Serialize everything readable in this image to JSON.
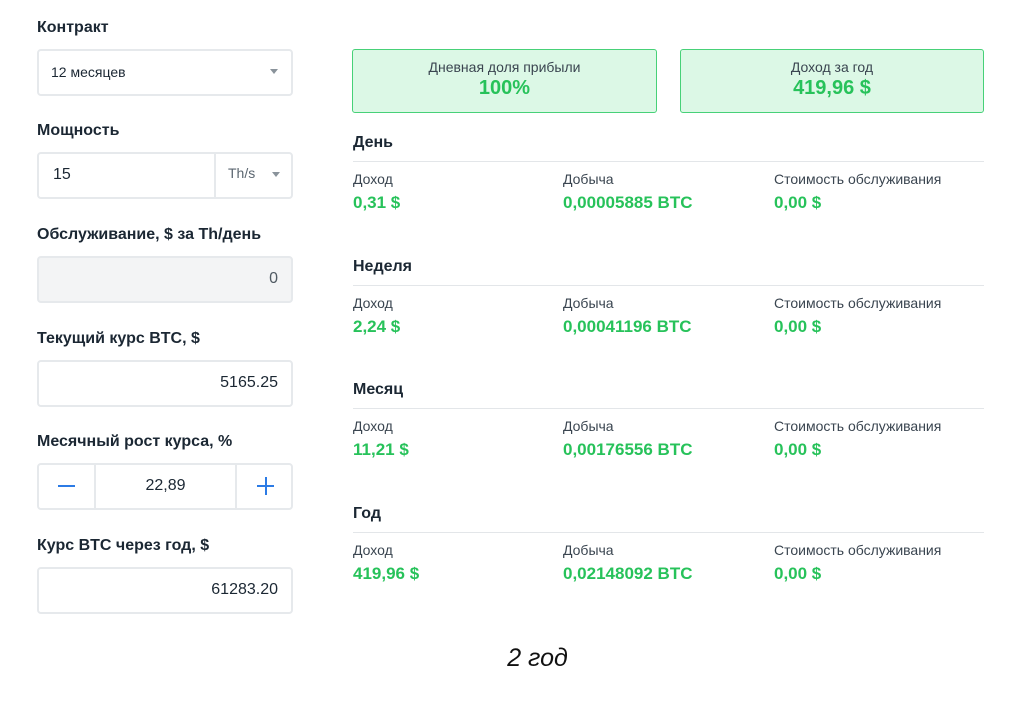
{
  "form": {
    "contract": {
      "label": "Контракт",
      "value": "12 месяцев"
    },
    "power": {
      "label": "Мощность",
      "value": "15",
      "unit": "Th/s"
    },
    "maintenance": {
      "label": "Обслуживание, $ за Th/день",
      "value": "0"
    },
    "btc_rate": {
      "label": "Текущий курс BTC, $",
      "value": "5165.25"
    },
    "monthly_growth": {
      "label": "Месячный рост курса, %",
      "value": "22,89"
    },
    "btc_rate_year": {
      "label": "Курс BTC через год, $",
      "value": "61283.20"
    }
  },
  "summary": {
    "daily_share": {
      "title": "Дневная доля прибыли",
      "value": "100%"
    },
    "year_income": {
      "title": "Доход за год",
      "value": "419,96 $"
    }
  },
  "sections": [
    {
      "title": "День",
      "income_label": "Доход",
      "income": "0,31 $",
      "mining_label": "Добыча",
      "mining": "0,00005885 BTC",
      "cost_label": "Стоимость обслуживания",
      "cost": "0,00 $"
    },
    {
      "title": "Неделя",
      "income_label": "Доход",
      "income": "2,24 $",
      "mining_label": "Добыча",
      "mining": "0,00041196 BTC",
      "cost_label": "Стоимость обслуживания",
      "cost": "0,00 $"
    },
    {
      "title": "Месяц",
      "income_label": "Доход",
      "income": "11,21 $",
      "mining_label": "Добыча",
      "mining": "0,00176556 BTC",
      "cost_label": "Стоимость обслуживания",
      "cost": "0,00 $"
    },
    {
      "title": "Год",
      "income_label": "Доход",
      "income": "419,96 $",
      "mining_label": "Добыча",
      "mining": "0,02148092 BTC",
      "cost_label": "Стоимость обслуживания",
      "cost": "0,00 $"
    }
  ],
  "caption": "2 год",
  "colors": {
    "accent_green": "#27c25a",
    "card_bg": "#dcf8e6",
    "stepper_blue": "#2c7be5"
  }
}
